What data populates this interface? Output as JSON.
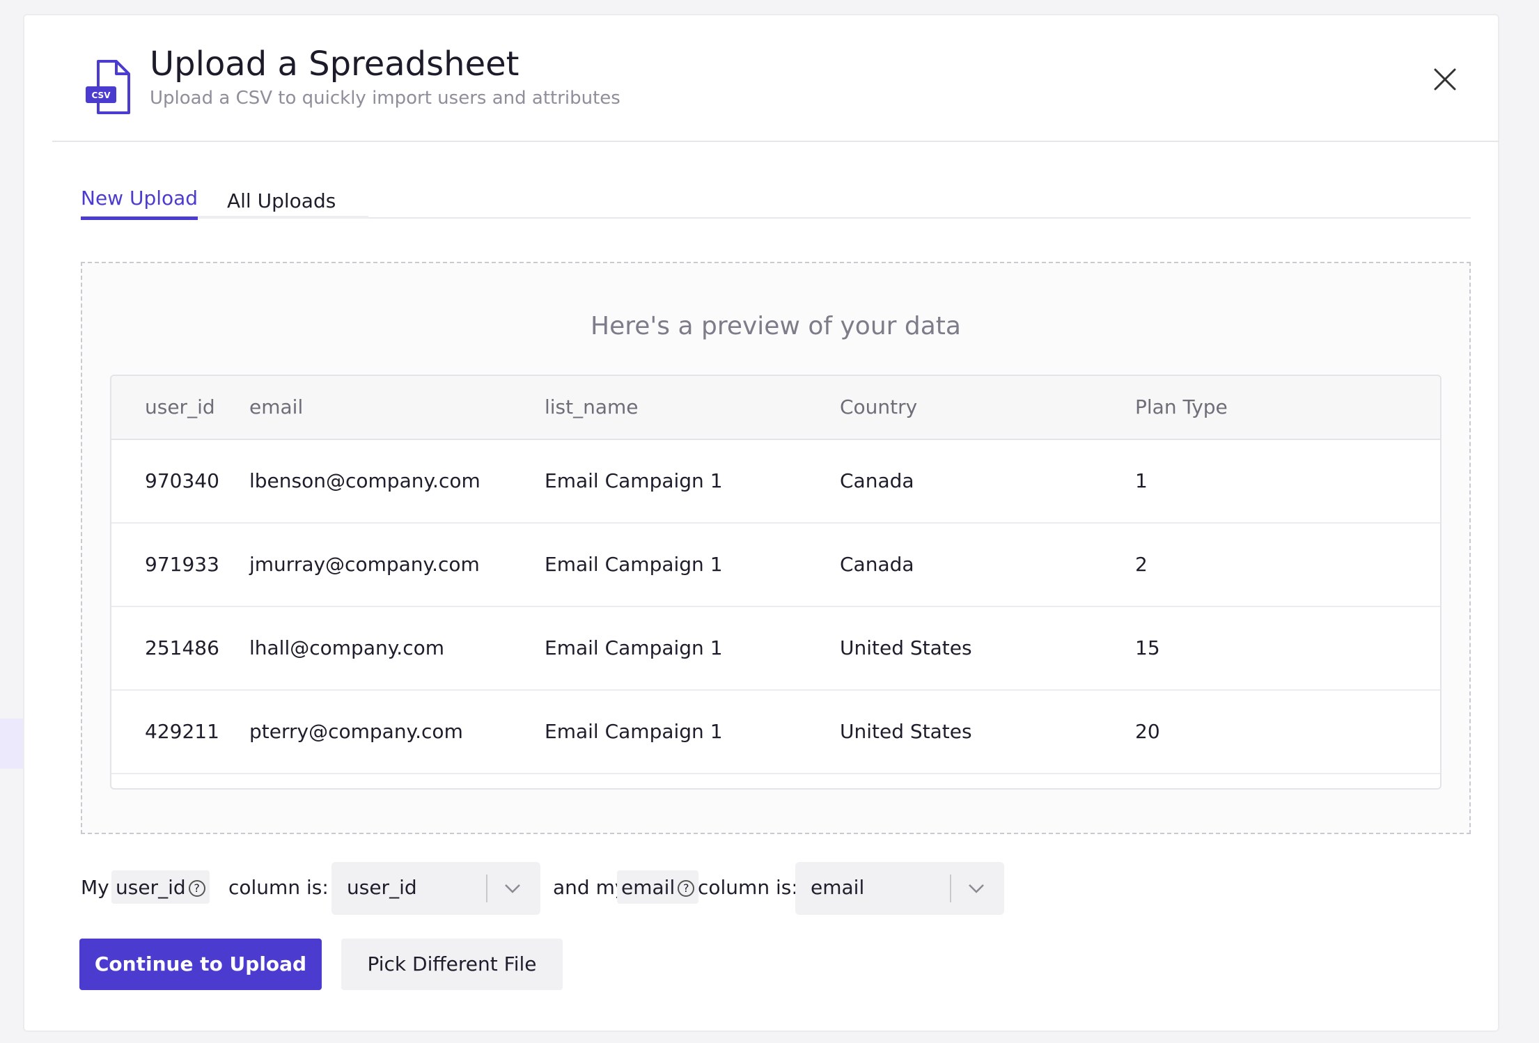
{
  "modal": {
    "title": "Upload a Spreadsheet",
    "subtitle": "Upload a CSV to quickly import users and attributes",
    "icon_label": "CSV",
    "accent_color": "#4c3bcf"
  },
  "tabs": [
    {
      "label": "New Upload",
      "active": true
    },
    {
      "label": "All Uploads",
      "active": false
    }
  ],
  "preview": {
    "title": "Here's a preview of your data",
    "columns": [
      "user_id",
      "email",
      "list_name",
      "Country",
      "Plan Type"
    ],
    "rows": [
      [
        "970340",
        "lbenson@company.com",
        "Email Campaign 1",
        "Canada",
        "1"
      ],
      [
        "971933",
        "jmurray@company.com",
        "Email Campaign 1",
        "Canada",
        "2"
      ],
      [
        "251486",
        "lhall@company.com",
        "Email Campaign 1",
        "United States",
        "15"
      ],
      [
        "429211",
        "pterry@company.com",
        "Email Campaign 1",
        "United States",
        "20"
      ]
    ]
  },
  "mapping": {
    "prefix": "My",
    "user_id_label": "user_id",
    "column_is_1": "column is:",
    "user_id_select": "user_id",
    "and_my": "and my",
    "email_label": "email",
    "column_is_2": "column is:",
    "email_select": "email"
  },
  "buttons": {
    "continue": "Continue to Upload",
    "pick_different": "Pick Different File"
  }
}
